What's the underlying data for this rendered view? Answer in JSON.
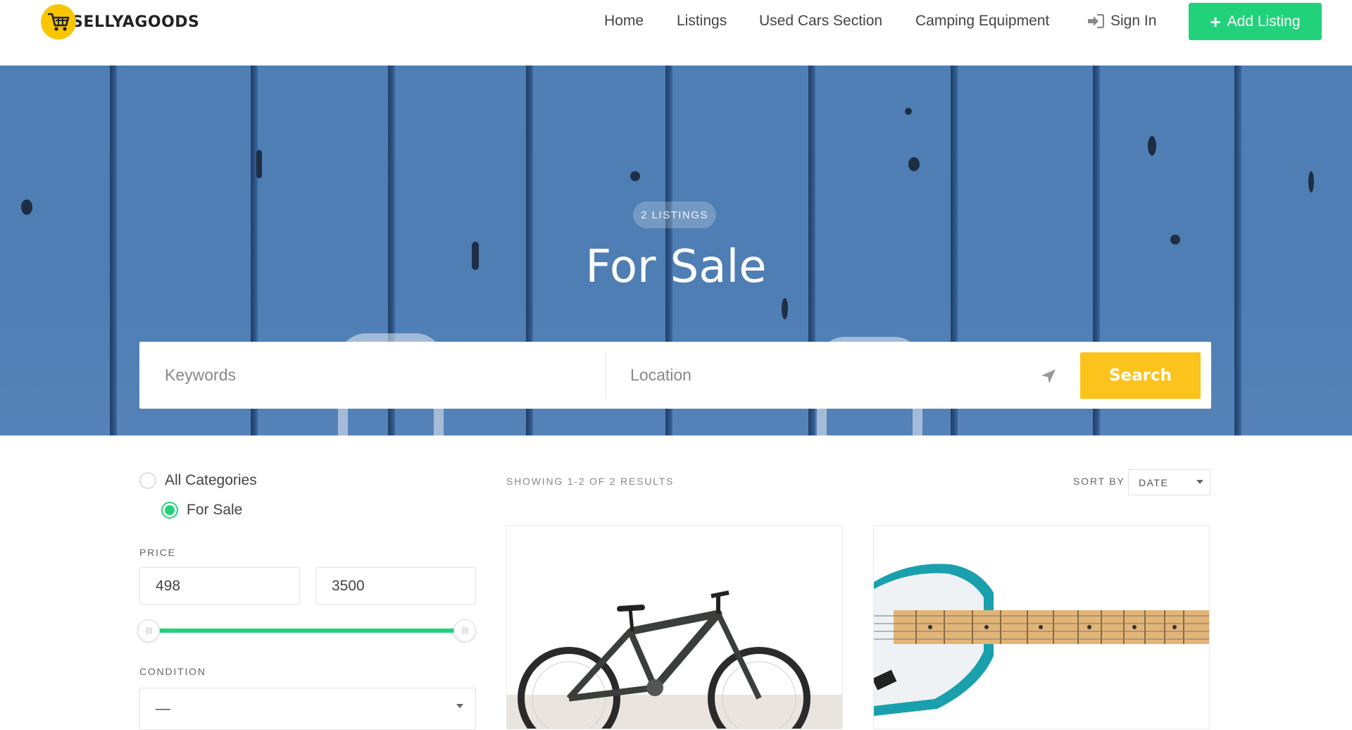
{
  "header": {
    "logo_text": "SELLYAGOODS",
    "nav": [
      "Home",
      "Listings",
      "Used Cars Section",
      "Camping Equipment"
    ],
    "sign_in": "Sign In",
    "add_listing": "Add Listing"
  },
  "hero": {
    "badge": "2 LISTINGS",
    "title": "For Sale",
    "keywords_placeholder": "Keywords",
    "location_placeholder": "Location",
    "search_label": "Search"
  },
  "sidebar": {
    "categories": [
      {
        "label": "All Categories",
        "checked": false
      },
      {
        "label": "For Sale",
        "checked": true
      }
    ],
    "price_label": "PRICE",
    "price_min": "498",
    "price_max": "3500",
    "condition_label": "CONDITION",
    "condition_value": "—"
  },
  "results": {
    "showing": "SHOWING 1-2 OF 2 RESULTS",
    "sort_by_label": "SORT BY",
    "sort_value": "DATE"
  },
  "colors": {
    "accent_green": "#22d27b",
    "search_yellow": "#fbc31b",
    "hero_blue": "#4f7fb5"
  }
}
